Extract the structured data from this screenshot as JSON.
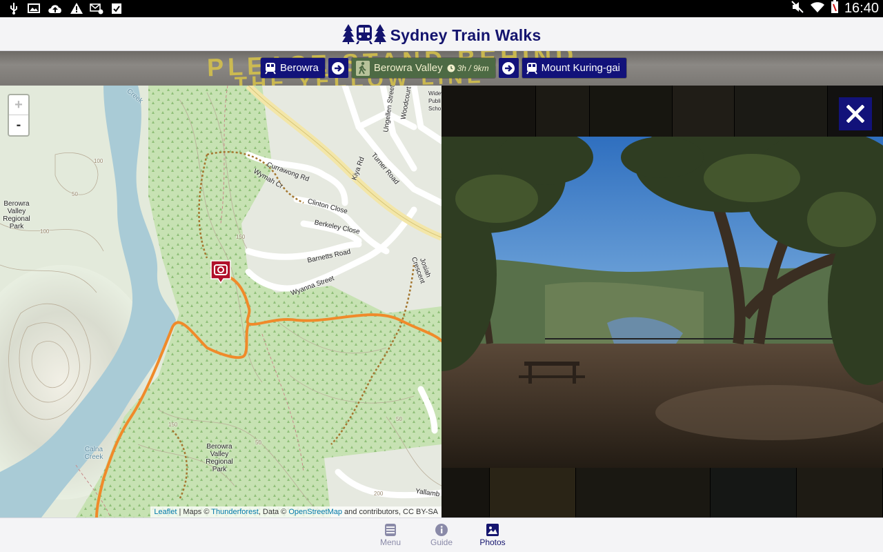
{
  "status_bar": {
    "clock": "16:40",
    "left_icons": [
      "usb-icon",
      "image-icon",
      "cloud-upload-icon",
      "warning-icon",
      "mail-settings-icon",
      "clipboard-check-icon"
    ],
    "right_icons": [
      "mute-icon",
      "wifi-icon",
      "battery-low-icon"
    ]
  },
  "header": {
    "title": "Sydney Train Walks",
    "logo_icons": [
      "tree-icon",
      "train-icon",
      "tree-icon"
    ]
  },
  "route": {
    "start_station": "Berowra",
    "walk_name": "Berowra Valley",
    "walk_duration": "3h / 9km",
    "end_station": "Mount Kuring-gai",
    "background_text": [
      "PLEASE STAND BEHIND",
      "THE YELLOW LINE"
    ]
  },
  "map": {
    "zoom_in": "+",
    "zoom_out": "-",
    "attribution": {
      "leaflet": "Leaflet",
      "maps_prefix": " | Maps © ",
      "thunderforest": "Thunderforest",
      "data_prefix": ", Data © ",
      "osm": "OpenStreetMap",
      "suffix": " and contributors, CC BY-SA"
    },
    "labels": {
      "park_left": "Berowra Valley Regional Park",
      "park_bottom": "Berowra Valley Regional Park",
      "calna_creek": "Calna Creek",
      "creek_top": "Creek",
      "currawong": "Currawong Rd",
      "wymah": "Wymah Cr",
      "clinton": "Clinton Close",
      "berkeley": "Berkeley Close",
      "barnetts": "Barnetts Road",
      "wyanna": "Wyanna Street",
      "turner": "Turner Road",
      "kiya": "Kiya Rd",
      "woodcourt": "Woodcourt",
      "ungellen": "Ungellen Street",
      "josiah": "Josiah Crescent",
      "yallambee": "Yallamb",
      "wideview": "Widev Publi Scho",
      "contour_100a": "100",
      "contour_50a": "50",
      "contour_100b": "100",
      "contour_150": "150",
      "contour_50b": "50",
      "contour_150b": "150",
      "contour_200": "200",
      "contour_50c": "50"
    }
  },
  "photo_viewer": {
    "close_label": "×"
  },
  "bottom_nav": {
    "items": [
      {
        "label": "Menu",
        "icon": "menu-icon",
        "active": false
      },
      {
        "label": "Guide",
        "icon": "info-icon",
        "active": false
      },
      {
        "label": "Photos",
        "icon": "photos-icon",
        "active": true
      }
    ]
  },
  "colors": {
    "brand_navy": "#12127a",
    "walk_chip_green": "#4d6a44",
    "track_orange": "#f08a2a",
    "poi_red": "#b0102a"
  }
}
